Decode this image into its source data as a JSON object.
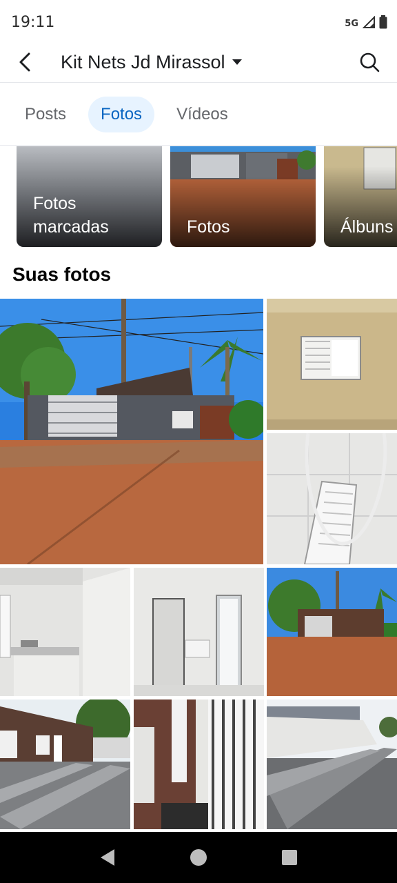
{
  "status_bar": {
    "time": "19:11",
    "network": "5G"
  },
  "header": {
    "title": "Kit Nets Jd Mirassol"
  },
  "tabs": [
    {
      "label": "Posts",
      "active": false
    },
    {
      "label": "Fotos",
      "active": true
    },
    {
      "label": "Vídeos",
      "active": false
    }
  ],
  "albums": [
    {
      "label_line1": "Fotos",
      "label_line2": "marcadas"
    },
    {
      "label": "Fotos"
    },
    {
      "label": "Álbuns"
    }
  ],
  "section": {
    "title": "Suas fotos"
  },
  "photos": [
    "street-house-gate",
    "room-window",
    "bathroom-door",
    "kitchen-sink",
    "laundry-bathroom",
    "street-house-small",
    "courtyard-kitnets",
    "side-alley-gate",
    "driveway-wall"
  ],
  "colors": {
    "accent": "#0a66c2",
    "accent_bg": "#e7f3ff",
    "nav_bar": "#000000"
  }
}
